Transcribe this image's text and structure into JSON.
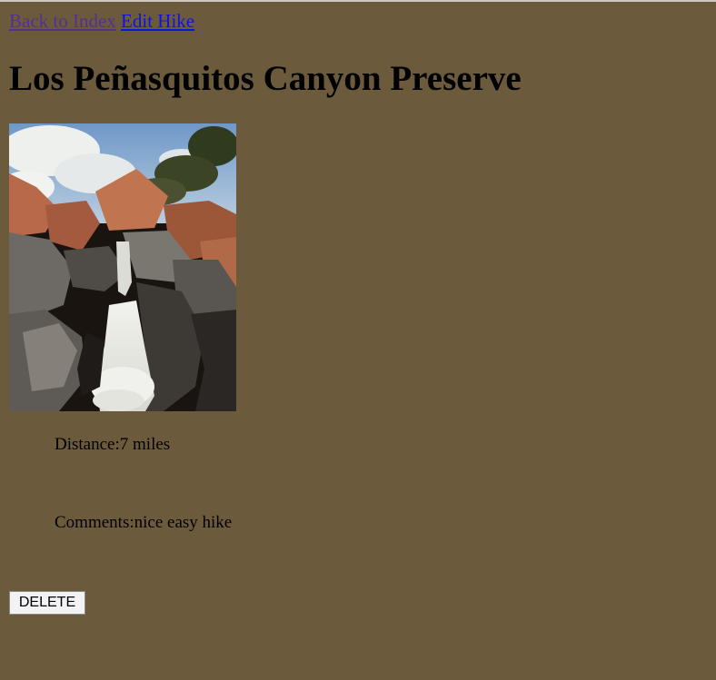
{
  "nav": {
    "back_label": "Back to Index",
    "edit_label": "Edit Hike"
  },
  "hike": {
    "title": "Los Peñasquitos Canyon Preserve",
    "distance_label": "Distance:",
    "distance_value": "7 miles",
    "comments_label": "Comments:",
    "comments_value": "nice easy hike"
  },
  "actions": {
    "delete_label": "DELETE"
  },
  "colors": {
    "background": "#6b5b3c",
    "visited_link": "#5a2e8c",
    "link": "#1010e8"
  }
}
